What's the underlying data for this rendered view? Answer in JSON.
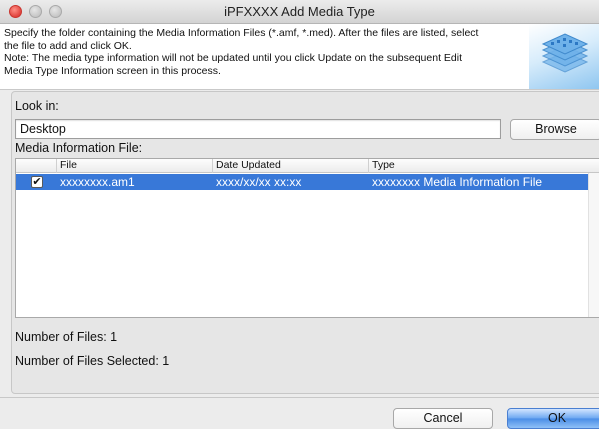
{
  "window": {
    "title": "iPFXXXX Add Media Type"
  },
  "header": {
    "lines": [
      "Specify the folder containing the Media Information Files (*.amf, *.med). After the files are listed, select",
      "the file to add and click OK.",
      "Note: The media type information will not be updated until you click Update on the subsequent Edit",
      "Media Type Information screen in this process."
    ]
  },
  "look_in": {
    "label": "Look in:",
    "value": "Desktop",
    "browse_label": "Browse"
  },
  "file_list": {
    "label": "Media Information File:",
    "columns": [
      "File",
      "Date Updated",
      "Type"
    ],
    "rows": [
      {
        "checked": true,
        "file": "xxxxxxxx.am1",
        "date": "xxxx/xx/xx xx:xx",
        "type": "xxxxxxxx Media Information File"
      }
    ]
  },
  "status": {
    "file_count": "Number of Files: 1",
    "selected_count": "Number of Files Selected: 1"
  },
  "buttons": {
    "cancel": "Cancel",
    "ok": "OK"
  },
  "colors": {
    "selection": "#3878d8",
    "ok_button": "#4a8de6"
  }
}
